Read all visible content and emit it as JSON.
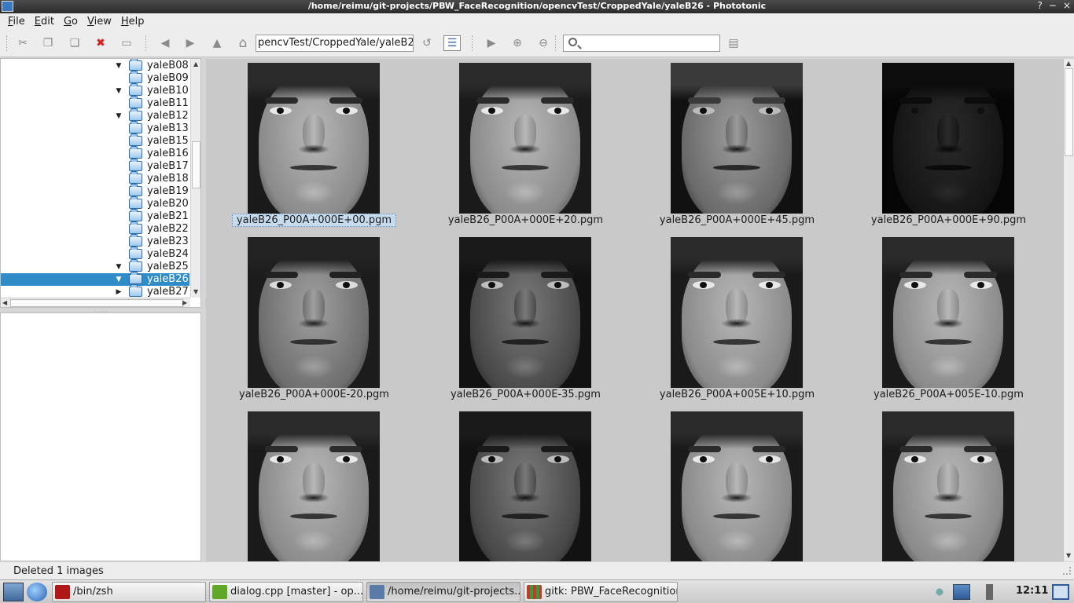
{
  "window": {
    "title": "/home/reimu/git-projects/PBW_FaceRecognition/opencvTest/CroppedYale/yaleB26 - Phototonic",
    "controls": [
      "?",
      "−",
      "×"
    ]
  },
  "menu": [
    {
      "label": "File",
      "mnemonic": "F",
      "rest": "ile"
    },
    {
      "label": "Edit",
      "mnemonic": "E",
      "rest": "dit"
    },
    {
      "label": "Go",
      "mnemonic": "G",
      "rest": "o"
    },
    {
      "label": "View",
      "mnemonic": "V",
      "rest": "iew"
    },
    {
      "label": "Help",
      "mnemonic": "H",
      "rest": "elp"
    }
  ],
  "toolbar": {
    "path_value": "pencvTest/CroppedYale/yaleB26",
    "search_placeholder": "",
    "icons": {
      "cut": "scissors-icon",
      "copy": "copy-icon",
      "paste": "paste-icon",
      "delete": "delete-icon",
      "rename": "rename-icon",
      "back": "arrow-left-icon",
      "forward": "arrow-right-icon",
      "up": "arrow-up-icon",
      "home": "home-icon",
      "refresh": "refresh-icon",
      "view_mode": "view-mode-icon",
      "slideshow": "play-icon",
      "zoom_in": "zoom-in-icon",
      "zoom_out": "zoom-out-icon",
      "settings": "settings-icon"
    },
    "glyphs": {
      "cut": "✂",
      "copy": "❐",
      "paste": "❏",
      "delete": "✖",
      "rename": "▭",
      "back": "◀",
      "forward": "▶",
      "up": "▲",
      "home": "⌂",
      "refresh": "↺",
      "view_mode": "☰",
      "slideshow": "▶",
      "zoom_in": "⊕",
      "zoom_out": "⊖",
      "settings": "▤"
    },
    "delete_color": "#d42020"
  },
  "tree": {
    "items": [
      {
        "label": "yaleB08",
        "arrow": "▼",
        "selected": false
      },
      {
        "label": "yaleB09",
        "arrow": "",
        "selected": false
      },
      {
        "label": "yaleB10",
        "arrow": "▼",
        "selected": false
      },
      {
        "label": "yaleB11",
        "arrow": "",
        "selected": false
      },
      {
        "label": "yaleB12",
        "arrow": "▼",
        "selected": false
      },
      {
        "label": "yaleB13",
        "arrow": "",
        "selected": false
      },
      {
        "label": "yaleB15",
        "arrow": "",
        "selected": false
      },
      {
        "label": "yaleB16",
        "arrow": "",
        "selected": false
      },
      {
        "label": "yaleB17",
        "arrow": "",
        "selected": false
      },
      {
        "label": "yaleB18",
        "arrow": "",
        "selected": false
      },
      {
        "label": "yaleB19",
        "arrow": "",
        "selected": false
      },
      {
        "label": "yaleB20",
        "arrow": "",
        "selected": false
      },
      {
        "label": "yaleB21",
        "arrow": "",
        "selected": false
      },
      {
        "label": "yaleB22",
        "arrow": "",
        "selected": false
      },
      {
        "label": "yaleB23",
        "arrow": "",
        "selected": false
      },
      {
        "label": "yaleB24",
        "arrow": "",
        "selected": false
      },
      {
        "label": "yaleB25",
        "arrow": "▼",
        "selected": false
      },
      {
        "label": "yaleB26",
        "arrow": "▼",
        "selected": true
      },
      {
        "label": "yaleB27",
        "arrow": "▶",
        "selected": false
      }
    ],
    "selection_color": "#308cc6"
  },
  "thumbnails": [
    {
      "filename": "yaleB26_P00A+000E+00.pgm",
      "selected": true,
      "light": "front"
    },
    {
      "filename": "yaleB26_P00A+000E+20.pgm",
      "selected": false,
      "light": "front"
    },
    {
      "filename": "yaleB26_P00A+000E+45.pgm",
      "selected": false,
      "light": "top"
    },
    {
      "filename": "yaleB26_P00A+000E+90.pgm",
      "selected": false,
      "light": "dark"
    },
    {
      "filename": "yaleB26_P00A+000E-20.pgm",
      "selected": false,
      "light": "low"
    },
    {
      "filename": "yaleB26_P00A+000E-35.pgm",
      "selected": false,
      "light": "lowdark"
    },
    {
      "filename": "yaleB26_P00A+005E+10.pgm",
      "selected": false,
      "light": "front"
    },
    {
      "filename": "yaleB26_P00A+005E-10.pgm",
      "selected": false,
      "light": "front"
    },
    {
      "filename": "",
      "selected": false,
      "light": "front"
    },
    {
      "filename": "",
      "selected": false,
      "light": "lowdark"
    },
    {
      "filename": "",
      "selected": false,
      "light": "front"
    },
    {
      "filename": "",
      "selected": false,
      "light": "front"
    }
  ],
  "status": {
    "text": "Deleted 1 images"
  },
  "taskbar": {
    "launchers": [
      "desktop-icon",
      "browser-globe-icon"
    ],
    "tasks": [
      {
        "label": "/bin/zsh",
        "icon": "terminal-icon",
        "color": "#b01818",
        "active": false
      },
      {
        "label": "dialog.cpp [master] - op...",
        "icon": "qt-creator-icon",
        "color": "#5fa82a",
        "active": false
      },
      {
        "label": "/home/reimu/git-projects...",
        "icon": "phototonic-icon",
        "color": "#5a7aa8",
        "active": true
      },
      {
        "label": "gitk: PBW_FaceRecognition",
        "icon": "gitk-icon",
        "color": "#c23a2a",
        "active": false
      }
    ],
    "tray": [
      "network-wireless-icon",
      "network-wired-icon",
      "volume-icon",
      "desktop-switch-icon"
    ],
    "clock": "12:11"
  }
}
